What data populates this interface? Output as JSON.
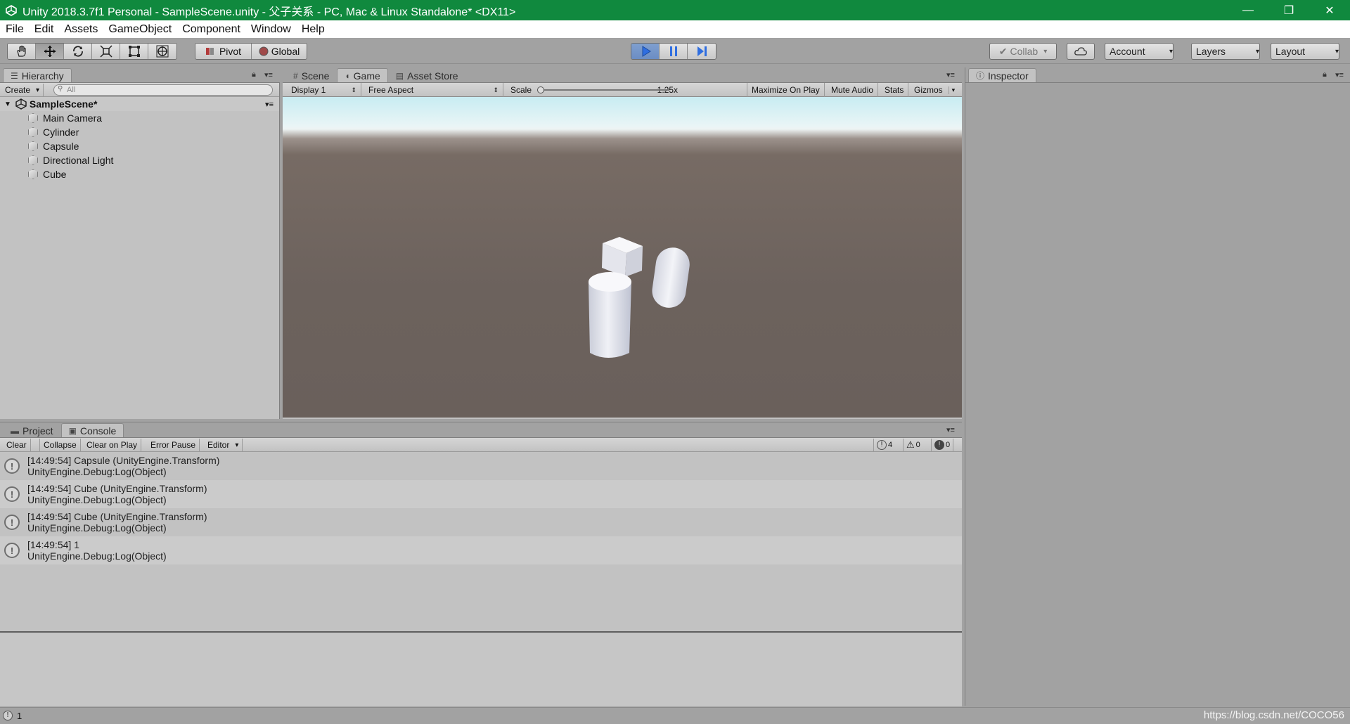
{
  "titlebar": {
    "title": "Unity 2018.3.7f1 Personal - SampleScene.unity - 父子关系 - PC, Mac & Linux Standalone* <DX11>",
    "minimize": "—",
    "restore": "❐",
    "close": "✕"
  },
  "menu": {
    "items": [
      "File",
      "Edit",
      "Assets",
      "GameObject",
      "Component",
      "Window",
      "Help"
    ]
  },
  "toolbar": {
    "pivot_label": "Pivot",
    "global_label": "Global",
    "collab_label": "Collab",
    "account_label": "Account",
    "layers_label": "Layers",
    "layout_label": "Layout",
    "transform_tools": [
      "hand-icon",
      "move-icon",
      "rotate-icon",
      "scale-icon",
      "rect-icon",
      "transform-icon"
    ],
    "play_controls": [
      "play-icon",
      "pause-icon",
      "step-icon"
    ],
    "accent_color": "#3c73d4"
  },
  "hierarchy": {
    "tab_label": "Hierarchy",
    "create_label": "Create",
    "search_placeholder": "All",
    "scene_name": "SampleScene*",
    "objects": [
      "Main Camera",
      "Cylinder",
      "Capsule",
      "Directional Light",
      "Cube"
    ]
  },
  "center": {
    "tabs": [
      "Scene",
      "Game",
      "Asset Store"
    ],
    "active_tab": "Game",
    "display": "Display 1",
    "aspect": "Free Aspect",
    "scale_label": "Scale",
    "scale_value": "1.25x",
    "maximize_label": "Maximize On Play",
    "mute_label": "Mute Audio",
    "stats_label": "Stats",
    "gizmos_label": "Gizmos"
  },
  "inspector": {
    "tab_label": "Inspector"
  },
  "bottom": {
    "tabs": [
      "Project",
      "Console"
    ],
    "active_tab": "Console",
    "buttons": {
      "clear": "Clear",
      "collapse": "Collapse",
      "clear_on_play": "Clear on Play",
      "error_pause": "Error Pause",
      "editor": "Editor"
    },
    "counts": {
      "info": "4",
      "warning": "0",
      "error": "0"
    },
    "logs": [
      {
        "message": "[14:49:54] Capsule (UnityEngine.Transform)",
        "trace": "UnityEngine.Debug:Log(Object)"
      },
      {
        "message": "[14:49:54] Cube (UnityEngine.Transform)",
        "trace": "UnityEngine.Debug:Log(Object)"
      },
      {
        "message": "[14:49:54] Cube (UnityEngine.Transform)",
        "trace": "UnityEngine.Debug:Log(Object)"
      },
      {
        "message": "[14:49:54] 1",
        "trace": "UnityEngine.Debug:Log(Object)"
      }
    ]
  },
  "status": {
    "text": "1",
    "watermark": "https://blog.csdn.net/COCO56"
  }
}
